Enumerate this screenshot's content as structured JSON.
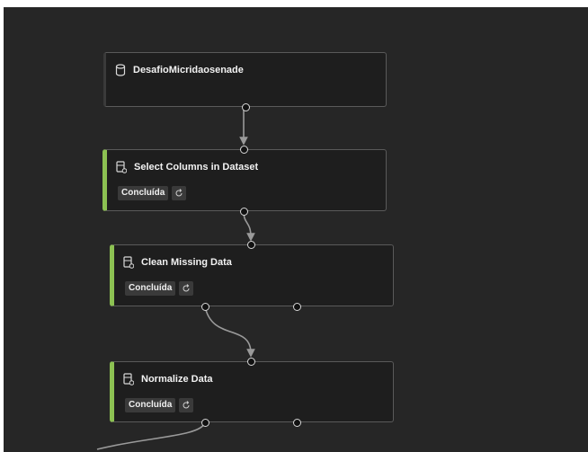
{
  "nodes": [
    {
      "id": "dataset",
      "title": "DesafioMicridaosenade",
      "icon": "dataset-cylinder-icon"
    },
    {
      "id": "select-columns",
      "title": "Select Columns in Dataset",
      "icon": "module-icon",
      "status": "Concluída",
      "status_icon": "refresh-icon"
    },
    {
      "id": "clean-missing",
      "title": "Clean Missing Data",
      "icon": "module-icon",
      "status": "Concluída",
      "status_icon": "refresh-icon"
    },
    {
      "id": "normalize",
      "title": "Normalize Data",
      "icon": "module-icon",
      "status": "Concluída",
      "status_icon": "refresh-icon"
    }
  ],
  "colors": {
    "canvas": "#262626",
    "node": "#1e1e1e",
    "node_border": "#5a5a5a",
    "completed_accent": "#8cc152",
    "edge": "#9a9a9a"
  }
}
